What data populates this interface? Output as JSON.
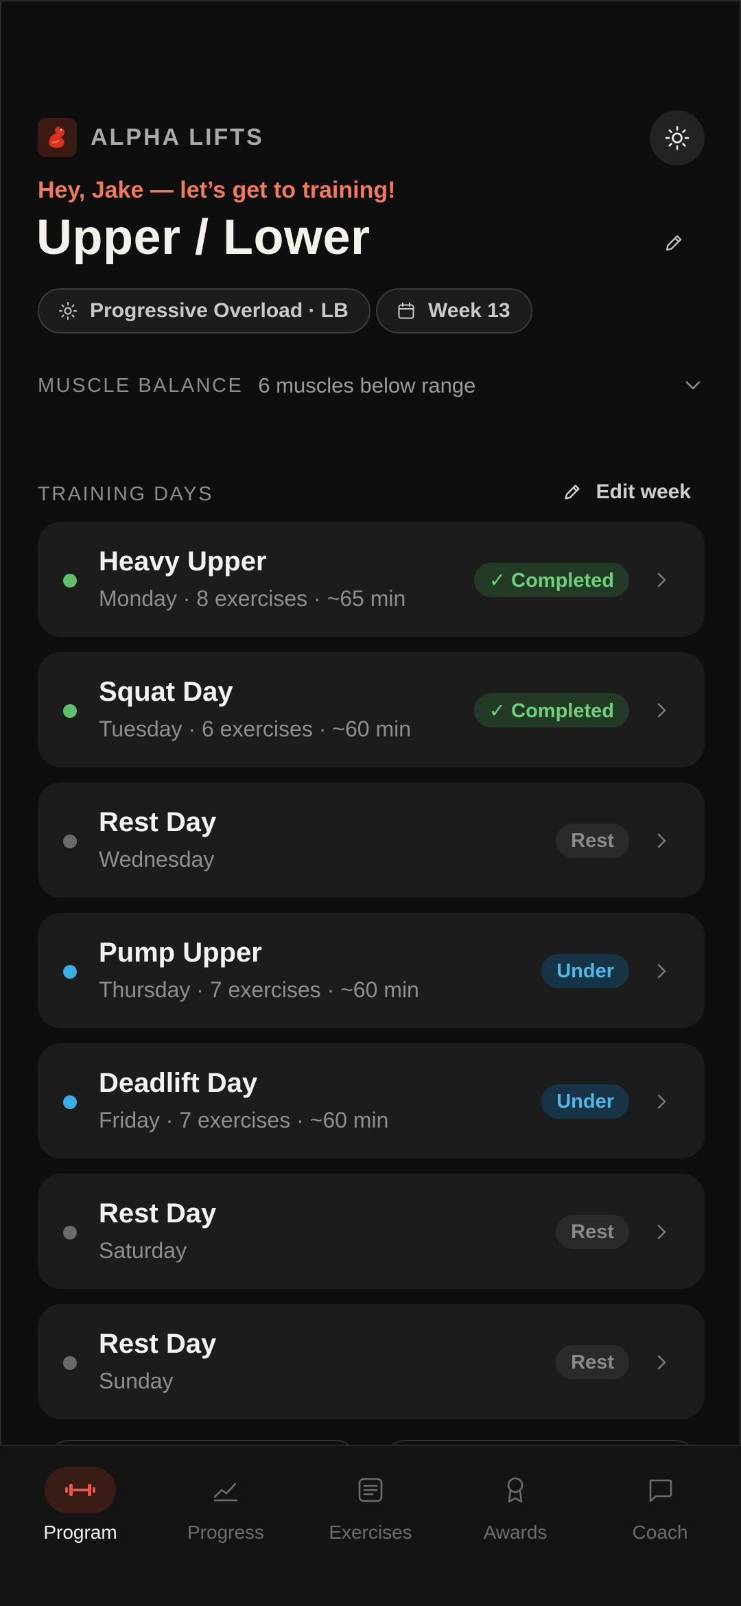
{
  "brand": {
    "name": "ALPHA LIFTS",
    "logo_icon": "dragon-logo-icon"
  },
  "header": {
    "greeting": "Hey, Jake — let’s get to training!",
    "program_title": "Upper / Lower",
    "chips": [
      {
        "label": "Progressive Overload · LB",
        "icon": "sparkle-icon"
      },
      {
        "label": "Week 13",
        "icon": "calendar-icon"
      }
    ]
  },
  "muscle_balance": {
    "label": "MUSCLE BALANCE",
    "value": "6 muscles below range"
  },
  "training_days": {
    "label": "TRAINING DAYS",
    "edit_label": "Edit week",
    "days": [
      {
        "name": "Heavy Upper",
        "meta": "Monday · 8 exercises · ~65 min",
        "status": "✓ Completed",
        "type": "completed",
        "dot_color": "#5fbf6a"
      },
      {
        "name": "Squat Day",
        "meta": "Tuesday · 6 exercises · ~60 min",
        "status": "✓ Completed",
        "type": "completed",
        "dot_color": "#5fbf6a"
      },
      {
        "name": "Rest Day",
        "meta": "Wednesday",
        "status": "Rest",
        "type": "rest",
        "dot_color": "#6a6a6a"
      },
      {
        "name": "Pump Upper",
        "meta": "Thursday · 7 exercises · ~60 min",
        "status": "Under",
        "type": "under",
        "dot_color": "#3aaee6"
      },
      {
        "name": "Deadlift Day",
        "meta": "Friday · 7 exercises · ~60 min",
        "status": "Under",
        "type": "under",
        "dot_color": "#3aaee6"
      },
      {
        "name": "Rest Day",
        "meta": "Saturday",
        "status": "Rest",
        "type": "rest",
        "dot_color": "#6a6a6a"
      },
      {
        "name": "Rest Day",
        "meta": "Sunday",
        "status": "Rest",
        "type": "rest",
        "dot_color": "#6a6a6a"
      }
    ]
  },
  "nav": {
    "items": [
      {
        "label": "Program",
        "icon": "dumbbell-icon",
        "active": true
      },
      {
        "label": "Progress",
        "icon": "chart-line-icon",
        "active": false
      },
      {
        "label": "Exercises",
        "icon": "list-icon",
        "active": false
      },
      {
        "label": "Awards",
        "icon": "award-icon",
        "active": false
      },
      {
        "label": "Coach",
        "icon": "chat-icon",
        "active": false
      }
    ]
  },
  "colors": {
    "accent": "#f07a5d",
    "background": "#0e0e0e",
    "card": "#1c1c1c"
  }
}
